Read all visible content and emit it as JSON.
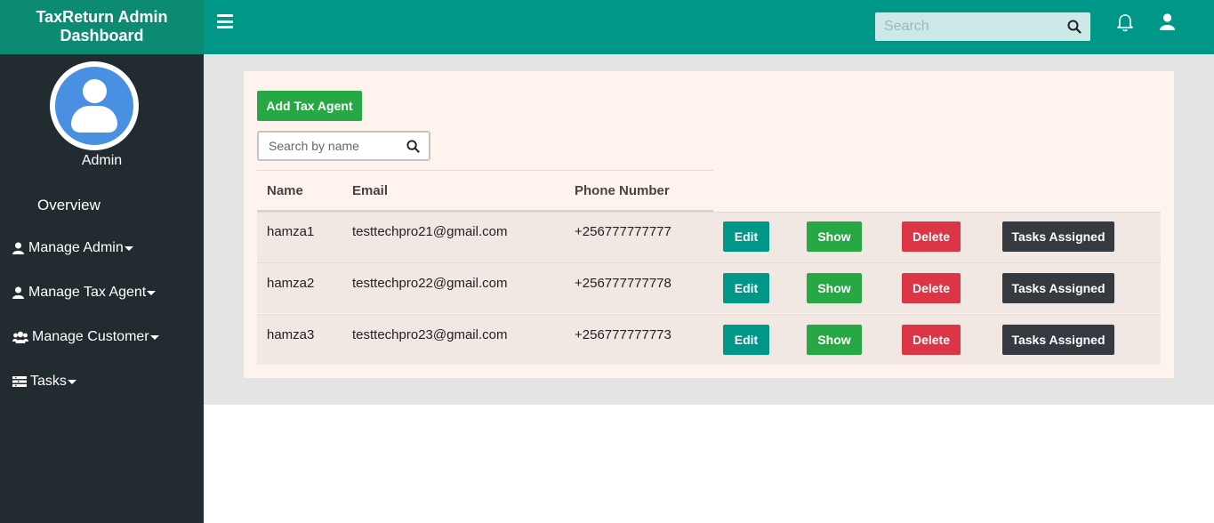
{
  "brand": {
    "line1": "TaxReturn Admin",
    "line2": "Dashboard"
  },
  "profile": {
    "name": "Admin"
  },
  "nav": {
    "overview": "Overview",
    "items": [
      {
        "label": "Manage Admin",
        "icon": "user-icon"
      },
      {
        "label": "Manage Tax Agent",
        "icon": "user-icon"
      },
      {
        "label": "Manage Customer",
        "icon": "users-icon"
      },
      {
        "label": "Tasks",
        "icon": "tasks-icon"
      }
    ]
  },
  "topbar": {
    "search_placeholder": "Search"
  },
  "main": {
    "add_button": "Add Tax Agent",
    "search_placeholder": "Search by name",
    "columns": [
      "Name",
      "Email",
      "Phone Number"
    ],
    "rows": [
      {
        "name": "hamza1",
        "email": "testtechpro21@gmail.com",
        "phone": "+256777777777"
      },
      {
        "name": "hamza2",
        "email": "testtechpro22@gmail.com",
        "phone": "+256777777778"
      },
      {
        "name": "hamza3",
        "email": "testtechpro23@gmail.com",
        "phone": "+256777777773"
      }
    ],
    "actions": {
      "edit": "Edit",
      "show": "Show",
      "delete": "Delete",
      "tasks": "Tasks Assigned"
    }
  },
  "colors": {
    "brand": "#0d8a72",
    "topbar": "#009688",
    "sidebar": "#222b30",
    "edit": "#009688",
    "show": "#28a745",
    "delete": "#dc3545",
    "tasks": "#343a40"
  }
}
